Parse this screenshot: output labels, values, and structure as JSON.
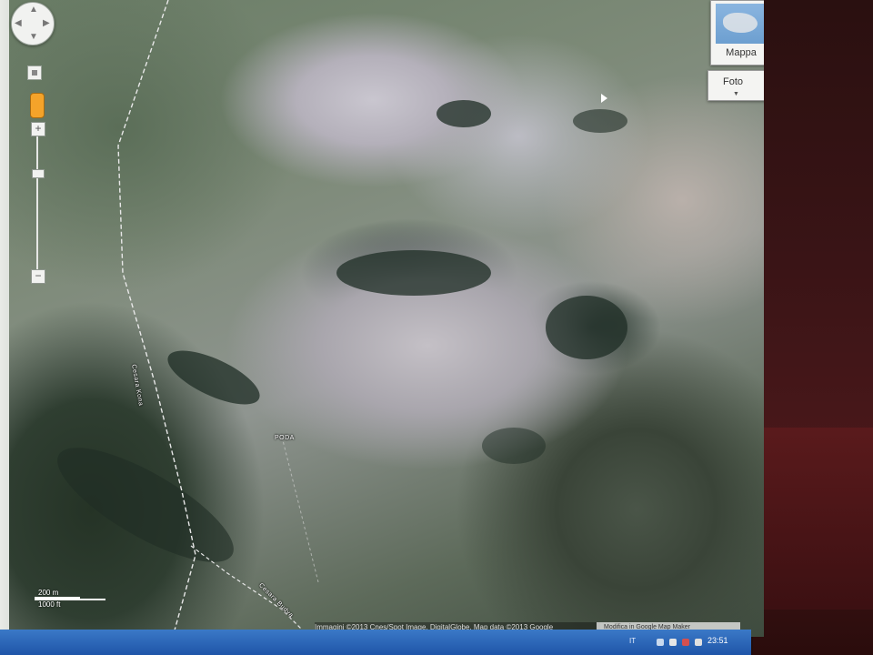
{
  "map": {
    "place_label": "PODA",
    "trail_labels": [
      "Cesara Kona",
      "Cesara Budva"
    ],
    "scale": {
      "upper": "200 m",
      "lower": "1000 ft"
    },
    "attribution": "Immagini ©2013 Cnes/Spot Image, DigitalGlobe, Map data ©2013 Google",
    "report_link": "Modifica in Google Map Maker"
  },
  "controls": {
    "map_type_label": "Mappa",
    "foto_label": "Foto",
    "zoom_in": "+",
    "zoom_out": "−"
  },
  "taskbar": {
    "language": "IT",
    "clock": "23:51"
  }
}
